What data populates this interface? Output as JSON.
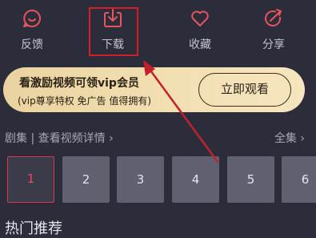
{
  "actions": [
    {
      "label": "反馈",
      "icon": "feedback-smile-icon"
    },
    {
      "label": "下载",
      "icon": "download-icon"
    },
    {
      "label": "收藏",
      "icon": "heart-icon"
    },
    {
      "label": "分享",
      "icon": "share-icon"
    }
  ],
  "vip": {
    "title": "看激励视频可领vip会员",
    "subtitle": "(vip尊享特权 免广告 值得拥有)",
    "button": "立即观看"
  },
  "episodes": {
    "header": "剧集 | 查看视频详情",
    "all_label": "全集",
    "items": [
      "1",
      "2",
      "3",
      "4",
      "5",
      "6"
    ],
    "selected": "1"
  },
  "section_title": "热门推荐",
  "colors": {
    "background": "#2c2d3a",
    "highlight_box": "#d41f2b",
    "active_episode": "#e3364b",
    "vip_gold": "#f2dfb2"
  }
}
